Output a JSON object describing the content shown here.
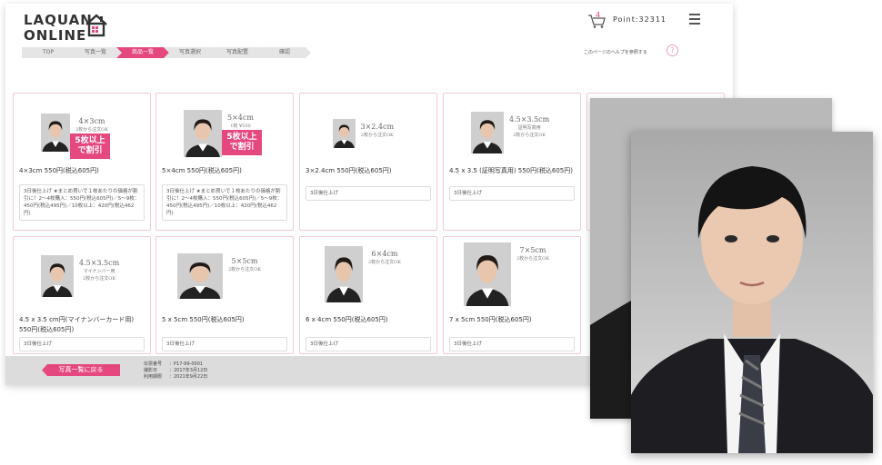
{
  "header": {
    "logo_text": "LAQUAN\nONLINE",
    "cart_count": "4",
    "point_label": "Point:32311"
  },
  "steps": [
    "TOP",
    "写真一覧",
    "商品一覧",
    "写真選択",
    "写真配置",
    "確認"
  ],
  "active_step": 2,
  "help_text": "このページのヘルプを参照する",
  "help_icon": "?",
  "products": [
    {
      "size": "4×3cm",
      "sub": "2枚から注文OK",
      "badge": "5枚以上\nで割引",
      "name": "4×3cm 550円(税込605円)",
      "desc": "3日後仕上げ ★まとめ買いで１枚あたりの価格が割引に！2～4枚購入：550円(税込605円)／5～9枚：450円(税込495円)／10枚以上：420円(税込462円)"
    },
    {
      "size": "5×4cm",
      "sub": "1枚 ¥550",
      "badge": "5枚以上\nで割引",
      "name": "5×4cm 550円(税込605円)",
      "desc": "3日後仕上げ ★まとめ買いで１枚あたりの価格が割引に！2～4枚購入：550円(税込605円)／5～9枚：450円(税込495円)／10枚以上：420円(税込462円)"
    },
    {
      "size": "3×2.4cm",
      "sub": "2枚から注文OK",
      "badge": "",
      "name": "3×2.4cm 550円(税込605円)",
      "desc": "3日後仕上げ"
    },
    {
      "size": "4.5×3.5cm",
      "sub": "証明写真用\n2枚から注文OK",
      "badge": "",
      "name": "4.5 x 3.5 (証明写真用) 550円(税込605円)",
      "desc": "3日後仕上げ"
    },
    {
      "size": "4.5×3.5cm",
      "sub": "マイナンバー用\n2枚から注文OK",
      "badge": "",
      "name": "4.5 x 3.5 cm円(マイナンバーカード用) 550円(税込605円)",
      "desc": "3日後仕上げ"
    },
    {
      "size": "5×5cm",
      "sub": "2枚から注文OK",
      "badge": "",
      "name": "5 x 5cm 550円(税込605円)",
      "desc": "3日後仕上げ"
    },
    {
      "size": "6×4cm",
      "sub": "2枚から注文OK",
      "badge": "",
      "name": "6 x 4cm 550円(税込605円)",
      "desc": "3日後仕上げ"
    },
    {
      "size": "7×5cm",
      "sub": "2枚から注文OK",
      "badge": "",
      "name": "7 x 5cm 550円(税込605円)",
      "desc": "3日後仕上げ"
    }
  ],
  "bottom": {
    "back_label": "写真一覧に戻る",
    "meta": [
      {
        "k": "伝票番号",
        "v": "：P17-99-0001"
      },
      {
        "k": "撮影日",
        "v": "：2017年3月12日"
      },
      {
        "k": "利用期限",
        "v": "：2021年9月22日"
      }
    ]
  },
  "colors": {
    "accent": "#e5487f",
    "card_border": "#f4c9d8"
  },
  "icons": {
    "cart": "cart-icon",
    "menu": "hamburger-menu-icon",
    "help": "help-circle-icon",
    "home": "house-icon"
  }
}
